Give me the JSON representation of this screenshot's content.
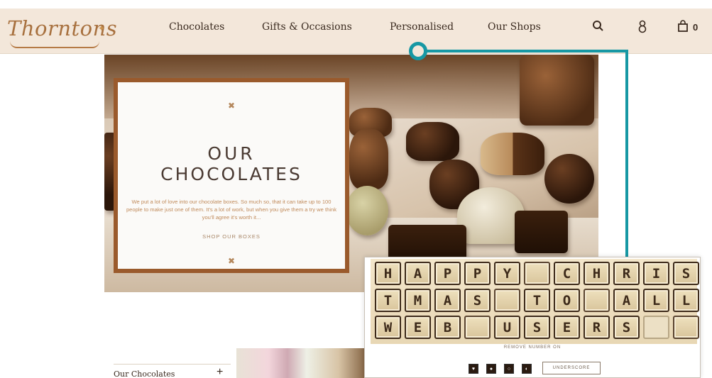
{
  "header": {
    "logo_text": "Thorntons",
    "nav": [
      {
        "label": "Chocolates"
      },
      {
        "label": "Gifts & Occasions"
      },
      {
        "label": "Personalised"
      },
      {
        "label": "Our Shops"
      }
    ],
    "icons": [
      "search-icon",
      "account-icon",
      "bag-icon"
    ],
    "bag_count": "0"
  },
  "hero": {
    "title_line1": "OUR",
    "title_line2": "CHOCOLATES",
    "body": "We put a lot of love into our chocolate boxes. So much so, that it can take up to 100 people to make just one of them. It's a lot of work, but when you give them a try we think you'll agree it's worth it...",
    "cta": "SHOP OUR BOXES"
  },
  "personalised_preview": {
    "rows": [
      [
        "H",
        "A",
        "P",
        "P",
        "Y",
        "",
        "C",
        "H",
        "R",
        "I",
        "S"
      ],
      [
        "T",
        "M",
        "A",
        "S",
        "",
        "T",
        "O",
        "",
        "A",
        "L",
        "L"
      ],
      [
        "W",
        "E",
        "B",
        "",
        "U",
        "S",
        "E",
        "R",
        "S",
        "",
        ""
      ]
    ],
    "caption": "REMOVE NUMBER ON",
    "button": "UNDERSCORE"
  },
  "bottom": {
    "nav_label": "Our Chocolates",
    "expand_symbol": "+"
  },
  "colors": {
    "header_bg": "#f3e7da",
    "accent_brown": "#9a5a2c",
    "callout_teal": "#1798a4",
    "logo_gold": "#a8713f"
  }
}
